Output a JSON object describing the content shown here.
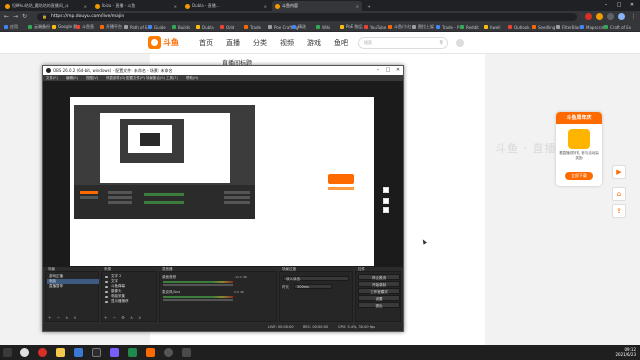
{
  "browser": {
    "tabs": [
      {
        "label": "坦畔ku咕咕_魔咕咕的直播间_斗",
        "active": false
      },
      {
        "label": "Ibiza - 直播 - 斗鱼",
        "active": false
      },
      {
        "label": "Dubla - 直播...",
        "active": false
      },
      {
        "label": "斗鱼内容",
        "active": true
      }
    ],
    "url": "https://mp.douyu.com/live/majin",
    "bookmarks": [
      "应用",
      "云端备份",
      "Google 翻",
      "斗鱼直",
      "开播平台",
      "Path of Ex",
      "Guide",
      "Builds",
      "Dubla",
      "Odd",
      "Trade",
      "Poe Crafting",
      "精选",
      "Wiki",
      "PoE 物品",
      "YouTube",
      "斗鱼/小红",
      "图拉上架",
      "Trade - P",
      "Reddit",
      "hwell",
      "Outlook",
      "Seedling",
      "FilterBlade",
      "Mapscraft",
      "Craft of Ex"
    ]
  },
  "site": {
    "logo": "斗鱼",
    "nav": [
      "首页",
      "直播",
      "分类",
      "视频",
      "游戏",
      "鱼吧"
    ],
    "search_placeholder": "搜索",
    "room_title": "直播间标题",
    "ghost_text": "斗鱼 · 直播",
    "ad": {
      "title": "斗鱼周年庆",
      "text": "看直播领好礼 参与活动赢奖励",
      "button": "立即下载"
    },
    "side_buttons": [
      "▶",
      "⌂",
      "⇪"
    ]
  },
  "obs": {
    "title": "OBS 26.0.2 (64-bit, windows) - 配置文件: 未命名 - 场景: 未命名",
    "menu": [
      "文件(F)",
      "编辑(E)",
      "视图(V)",
      "停靠部件(D)",
      "配置文件(P)",
      "场景集合(S)",
      "工具(T)",
      "帮助(H)"
    ],
    "docks": {
      "scenes_title": "场景",
      "scenes": [
        "游戏正播",
        "电脑",
        "直播暂停"
      ],
      "sources_title": "来源",
      "sources": [
        "文字 2",
        "文字",
        "斗鱼弹幕",
        "摄像头",
        "电脑采集",
        "显示器捕获"
      ],
      "mixer_title": "混音器",
      "mixer": [
        {
          "name": "桌面音频",
          "db": "-14.2 dB"
        },
        {
          "name": "麦克风/Aux",
          "db": "0.0 dB"
        }
      ],
      "transitions_title": "场景过渡",
      "transition_label": "时长",
      "transition_value": "300ms",
      "controls_title": "控件",
      "controls": [
        "停止推流",
        "开始录制",
        "工作室模式",
        "设置",
        "退出"
      ]
    },
    "status": {
      "live": "LIVE: 00:00:00",
      "rec": "REC: 00:00:00",
      "cpu": "CPU: 3.4%, 30.00 fps"
    }
  },
  "taskbar": {
    "time": "09:12",
    "date": "2021/6/23"
  }
}
